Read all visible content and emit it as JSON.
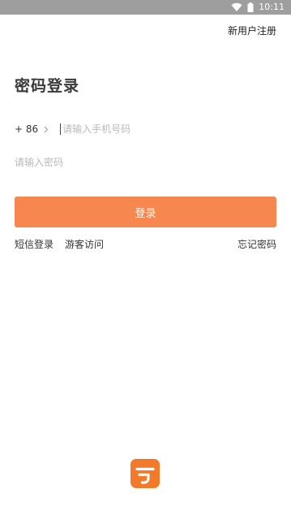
{
  "status_bar": {
    "time": "10:11",
    "icons": [
      "wifi-icon",
      "battery-icon"
    ]
  },
  "header": {
    "register_label": "新用户注册"
  },
  "title": "密码登录",
  "phone": {
    "country_code": "+ 86",
    "placeholder": "请输入手机号码"
  },
  "password": {
    "placeholder": "请输入密码"
  },
  "login_button": "登录",
  "links": {
    "sms_login": "短信登录",
    "guest_visit": "游客访问",
    "forgot_password": "忘记密码"
  },
  "colors": {
    "accent": "#f6874e",
    "logo": "#f27a2a",
    "status_bar": "#9e9e9e"
  }
}
